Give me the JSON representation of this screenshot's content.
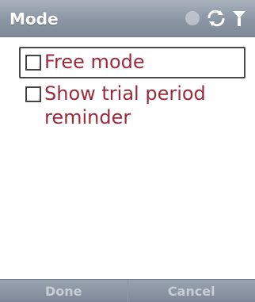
{
  "window": {
    "title": "Mode"
  },
  "status": {
    "icons": [
      "speaker-icon",
      "sync-icon",
      "signal-icon"
    ]
  },
  "options": [
    {
      "label": "Free mode",
      "checked": false,
      "focused": true
    },
    {
      "label": "Show trial period reminder",
      "checked": false,
      "focused": false
    }
  ],
  "softkeys": {
    "left": "Done",
    "right": "Cancel"
  },
  "colors": {
    "accent_text": "#9b2a3b",
    "titlebar": "#8b95a3"
  }
}
